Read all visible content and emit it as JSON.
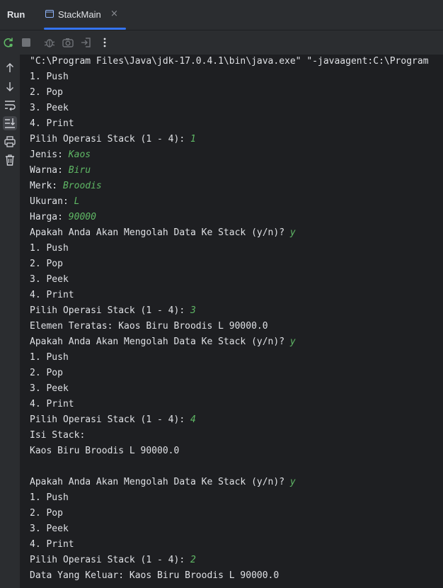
{
  "run_panel": {
    "label": "Run",
    "tab_title": "StackMain",
    "tab_close": "×"
  },
  "toolbar": {
    "icons": [
      "rerun-icon",
      "stop-icon",
      "debug-icon",
      "screenshot-icon",
      "exit-icon",
      "more-icon"
    ]
  },
  "sidebar": {
    "icons": [
      "arrow-up-icon",
      "arrow-down-icon",
      "soft-wrap-icon",
      "scroll-to-end-icon",
      "print-icon",
      "trash-icon"
    ]
  },
  "console": {
    "lines": [
      {
        "text": "\"C:\\Program Files\\Java\\jdk-17.0.4.1\\bin\\java.exe\" \"-javaagent:C:\\Program",
        "input": ""
      },
      {
        "text": "1. Push",
        "input": ""
      },
      {
        "text": "2. Pop",
        "input": ""
      },
      {
        "text": "3. Peek",
        "input": ""
      },
      {
        "text": "4. Print",
        "input": ""
      },
      {
        "text": "Pilih Operasi Stack (1 - 4): ",
        "input": "1"
      },
      {
        "text": "Jenis: ",
        "input": "Kaos"
      },
      {
        "text": "Warna: ",
        "input": "Biru"
      },
      {
        "text": "Merk: ",
        "input": "Broodis"
      },
      {
        "text": "Ukuran: ",
        "input": "L"
      },
      {
        "text": "Harga: ",
        "input": "90000"
      },
      {
        "text": "Apakah Anda Akan Mengolah Data Ke Stack (y/n)? ",
        "input": "y"
      },
      {
        "text": "1. Push",
        "input": ""
      },
      {
        "text": "2. Pop",
        "input": ""
      },
      {
        "text": "3. Peek",
        "input": ""
      },
      {
        "text": "4. Print",
        "input": ""
      },
      {
        "text": "Pilih Operasi Stack (1 - 4): ",
        "input": "3"
      },
      {
        "text": "Elemen Teratas: Kaos Biru Broodis L 90000.0",
        "input": ""
      },
      {
        "text": "Apakah Anda Akan Mengolah Data Ke Stack (y/n)? ",
        "input": "y"
      },
      {
        "text": "1. Push",
        "input": ""
      },
      {
        "text": "2. Pop",
        "input": ""
      },
      {
        "text": "3. Peek",
        "input": ""
      },
      {
        "text": "4. Print",
        "input": ""
      },
      {
        "text": "Pilih Operasi Stack (1 - 4): ",
        "input": "4"
      },
      {
        "text": "Isi Stack:",
        "input": ""
      },
      {
        "text": "Kaos Biru Broodis L 90000.0",
        "input": ""
      },
      {
        "text": "",
        "input": ""
      },
      {
        "text": "Apakah Anda Akan Mengolah Data Ke Stack (y/n)? ",
        "input": "y"
      },
      {
        "text": "1. Push",
        "input": ""
      },
      {
        "text": "2. Pop",
        "input": ""
      },
      {
        "text": "3. Peek",
        "input": ""
      },
      {
        "text": "4. Print",
        "input": ""
      },
      {
        "text": "Pilih Operasi Stack (1 - 4): ",
        "input": "2"
      },
      {
        "text": "Data Yang Keluar: Kaos Biru Broodis L 90000.0",
        "input": ""
      }
    ]
  },
  "colors": {
    "background": "#1e1f22",
    "panel": "#2b2d30",
    "text": "#dfe1e5",
    "user_input": "#5fb865",
    "accent": "#3574f0"
  }
}
